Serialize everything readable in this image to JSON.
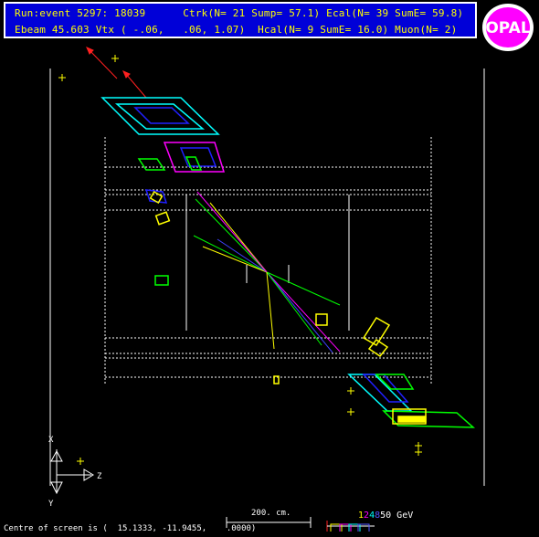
{
  "header": {
    "line1": "Run:event 5297: 18039      Ctrk(N= 21 Sump= 57.1) Ecal(N= 39 SumE= 59.8)",
    "line2": "Ebeam 45.603 Vtx ( -.06,   .06, 1.07)  Hcal(N= 9 SumE= 16.0) Muon(N= 2)",
    "text_color": "#ffff00",
    "background": "#0000d8"
  },
  "logo": {
    "text": "OPAL",
    "colors": {
      "fill": "#ff00ff",
      "ring": "#ffffff",
      "letters": "#ff00ff"
    }
  },
  "axes": {
    "x_label": "X",
    "y_label": "Y",
    "z_label": "Z"
  },
  "footer": {
    "centre_text": "Centre of screen is (  15.1333, -11.9455,    .0000)",
    "scale_label": "200. cm.",
    "energy_scale": {
      "segments": [
        {
          "label": "1",
          "color": "#ffff00"
        },
        {
          "label": "2",
          "color": "#ff00ff"
        },
        {
          "label": "4",
          "color": "#00ffff"
        },
        {
          "label": "8",
          "color": "#5555ff"
        },
        {
          "label": "50 GeV",
          "color": "#ffffff"
        }
      ]
    }
  },
  "colors": {
    "tracks_green": "#00ff00",
    "tracks_yellow": "#ffff00",
    "tracks_magenta": "#ff00ff",
    "tracks_blue": "#4040ff",
    "muon_red": "#ff2020",
    "ecal_cyan": "#00ffff",
    "detector_white": "#ffffff"
  }
}
